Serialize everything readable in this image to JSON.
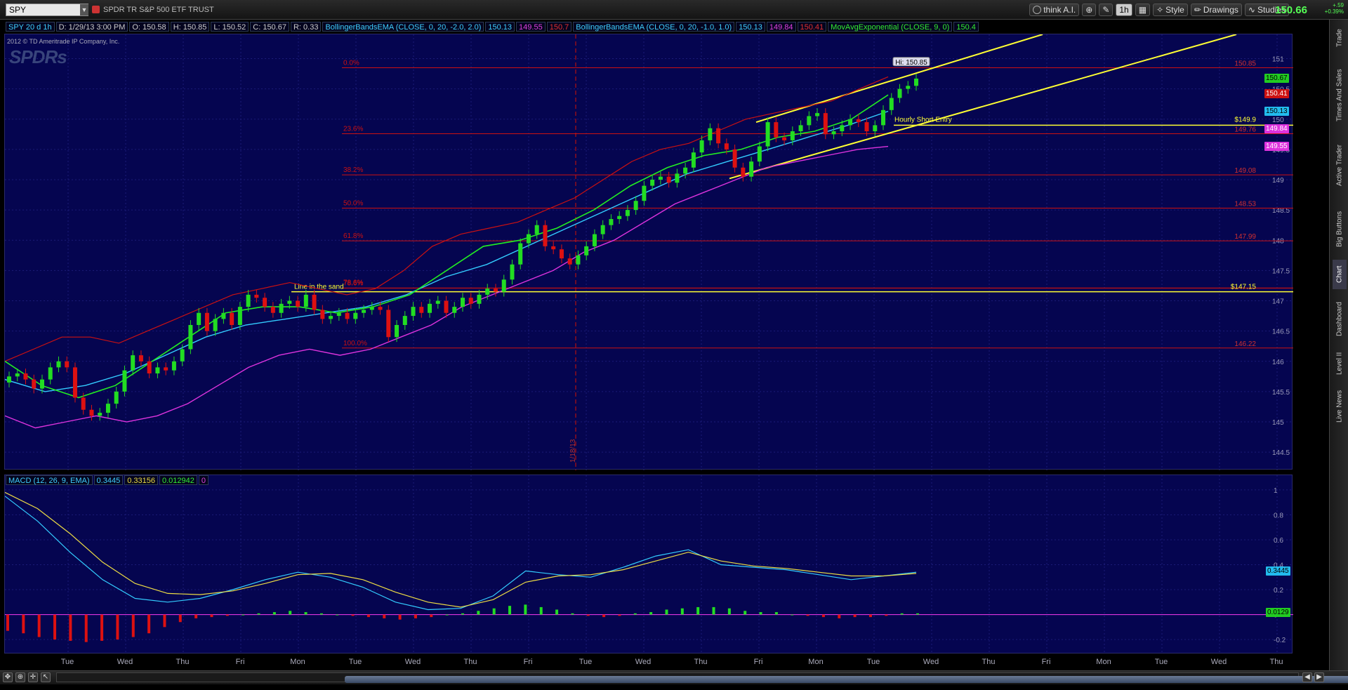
{
  "toolbar": {
    "symbol": "SPY",
    "symbol_title": "SPDR TR S&P 500 ETF TRUST",
    "think_label": "think A.I.",
    "timeframe": "1h",
    "style_label": "Style",
    "drawings_label": "Drawings",
    "studies_label": "Studies",
    "last_price": "150.66",
    "change_abs": "+.59",
    "change_pct": "+0.39%"
  },
  "studybar": {
    "period": "SPY 20 d 1h",
    "date": "D: 1/29/13 3:00 PM",
    "open": "O: 150.58",
    "high": "H: 150.85",
    "low": "L: 150.52",
    "close": "C: 150.67",
    "range": "R: 0.33",
    "bb1_name": "BollingerBandsEMA (CLOSE, 0, 20, -2.0, 2.0)",
    "bb1_mid": "150.13",
    "bb1_low": "149.55",
    "bb1_up": "150.7",
    "bb2_name": "BollingerBandsEMA (CLOSE, 0, 20, -1.0, 1.0)",
    "bb2_mid": "150.13",
    "bb2_low": "149.84",
    "bb2_up": "150.41",
    "ema_name": "MovAvgExponential (CLOSE, 9, 0)",
    "ema_val": "150.4"
  },
  "watermark": {
    "copyright": "2012 © TD Ameritrade IP Company, Inc.",
    "logo_text": "SPDRs"
  },
  "annotations": {
    "high_label": "Hi: 150.85",
    "hourly_short": "Hourly Short Entry",
    "line_in_sand": "Line in the sand",
    "date_marker": "1/18/13",
    "fib_0": "0.0%",
    "fib_236": "23.6%",
    "fib_382": "38.2%",
    "fib_50": "50.0%",
    "fib_618": "61.8%",
    "fib_786": "78.6%",
    "fib_100": "100.0%"
  },
  "price_tags": {
    "t_150_85": "150.85",
    "t_149_9": "$149.9",
    "t_149_76": "149.76",
    "t_149_08": "149.08",
    "t_148_53": "148.53",
    "t_147_99": "147.99",
    "t_147_15": "$147.15",
    "t_146_22": "146.22"
  },
  "axis_tags": {
    "last": "150.67",
    "bb_up": "150.41",
    "mid": "150.13",
    "bb_low1": "149.84",
    "bb_low2": "149.55",
    "macd_val": "0.3445",
    "hist_val": "0.0129"
  },
  "macd_legend": {
    "name": "MACD (12, 26, 9, EMA)",
    "value": "0.3445",
    "avg": "0.33156",
    "diff": "0.012942",
    "zero": "0"
  },
  "rail_tabs": [
    "Trade",
    "Times And Sales",
    "Active Trader",
    "Big Buttons",
    "Chart",
    "Dashboard",
    "Level II",
    "Live News"
  ],
  "colors": {
    "bg": "#050550",
    "up": "#22dd22",
    "down": "#dd1111",
    "yellow": "#ffff33",
    "cyan": "#33ccff",
    "magenta": "#dd33dd",
    "bb_outer": "#cc1111",
    "green_ema": "#22ee22",
    "fib": "#cc1111"
  },
  "chart_data": [
    {
      "type": "candlestick",
      "title": "SPY 20 d 1h",
      "x_day_labels": [
        "Tue",
        "Wed",
        "Thu",
        "Fri",
        "Mon",
        "Tue",
        "Wed",
        "Thu",
        "Fri",
        "Tue",
        "Wed",
        "Thu",
        "Fri",
        "Mon",
        "Tue",
        "Wed",
        "Thu",
        "Fri",
        "Mon",
        "Tue",
        "Wed",
        "Thu"
      ],
      "y_ticks": [
        144.5,
        145,
        145.5,
        146,
        146.5,
        147,
        147.5,
        148,
        148.5,
        149,
        149.5,
        150,
        150.5,
        151
      ],
      "ylim": [
        144.2,
        151.4
      ],
      "fib_levels": [
        {
          "label": "0.0%",
          "price": 150.85
        },
        {
          "label": "23.6%",
          "price": 149.76
        },
        {
          "label": "38.2%",
          "price": 149.08
        },
        {
          "label": "50.0%",
          "price": 148.53
        },
        {
          "label": "61.8%",
          "price": 147.99
        },
        {
          "label": "78.6%",
          "price": 147.21
        },
        {
          "label": "100.0%",
          "price": 146.22
        }
      ],
      "horizontal_lines": [
        {
          "label": "Line in the sand",
          "price": 147.15
        },
        {
          "label": "Hourly Short Entry",
          "price": 149.9
        }
      ],
      "closes": [
        145.75,
        145.8,
        145.7,
        145.55,
        145.7,
        145.9,
        146.0,
        145.9,
        145.4,
        145.2,
        145.1,
        145.15,
        145.3,
        145.5,
        145.85,
        146.1,
        146.0,
        145.8,
        145.9,
        145.85,
        146.0,
        146.2,
        146.6,
        146.8,
        146.5,
        146.7,
        146.8,
        146.6,
        146.9,
        147.1,
        147.05,
        146.9,
        146.8,
        146.95,
        147.0,
        146.9,
        147.1,
        146.85,
        146.7,
        146.75,
        146.8,
        146.7,
        146.8,
        146.85,
        146.9,
        146.85,
        146.4,
        146.6,
        146.75,
        146.9,
        146.8,
        146.95,
        147.0,
        146.8,
        146.9,
        147.05,
        146.95,
        147.1,
        147.2,
        147.15,
        147.35,
        147.6,
        147.95,
        148.1,
        148.25,
        147.9,
        147.85,
        147.7,
        147.6,
        147.75,
        147.9,
        148.1,
        148.25,
        148.35,
        148.4,
        148.5,
        148.65,
        148.9,
        149.0,
        149.05,
        148.95,
        149.1,
        149.2,
        149.45,
        149.65,
        149.85,
        149.6,
        149.5,
        149.2,
        149.05,
        149.3,
        149.55,
        149.95,
        149.7,
        149.65,
        149.8,
        149.9,
        150.05,
        150.1,
        149.75,
        149.8,
        149.9,
        150.0,
        149.95,
        149.8,
        149.9,
        150.15,
        150.35,
        150.5,
        150.55,
        150.67
      ],
      "bb_upper": [
        146.0,
        146.2,
        146.4,
        146.4,
        146.3,
        146.5,
        146.7,
        146.9,
        147.1,
        147.2,
        147.3,
        147.2,
        147.1,
        147.2,
        147.5,
        147.9,
        148.1,
        148.2,
        148.3,
        148.5,
        148.7,
        149.0,
        149.3,
        149.5,
        149.6,
        149.8,
        150.0,
        150.1,
        150.2,
        150.3,
        150.5,
        150.7
      ],
      "bb_lower": [
        145.1,
        144.9,
        145.0,
        145.1,
        145.0,
        145.1,
        145.3,
        145.6,
        145.9,
        146.1,
        146.2,
        146.1,
        146.2,
        146.4,
        146.6,
        146.9,
        147.1,
        147.3,
        147.5,
        147.8,
        148.0,
        148.3,
        148.6,
        148.8,
        149.0,
        149.2,
        149.3,
        149.4,
        149.5,
        149.55
      ],
      "ema9": [
        146.0,
        145.6,
        145.4,
        145.6,
        146.0,
        146.4,
        146.8,
        146.9,
        146.9,
        146.8,
        146.9,
        147.1,
        147.5,
        147.9,
        148.0,
        148.2,
        148.5,
        148.9,
        149.2,
        149.4,
        149.5,
        149.7,
        149.8,
        150.0,
        150.4
      ],
      "bb_mid": [
        145.7,
        145.5,
        145.6,
        145.8,
        146.1,
        146.4,
        146.6,
        146.7,
        146.8,
        146.9,
        147.1,
        147.4,
        147.6,
        147.9,
        148.2,
        148.5,
        148.8,
        149.1,
        149.3,
        149.5,
        149.7,
        149.9,
        150.13
      ]
    },
    {
      "type": "line",
      "title": "MACD (12, 26, 9, EMA)",
      "ylim": [
        -0.25,
        1.05
      ],
      "y_ticks": [
        -0.2,
        0,
        0.2,
        0.4,
        0.6,
        0.8,
        1
      ],
      "series": [
        {
          "name": "Value",
          "values": [
            0.95,
            0.75,
            0.5,
            0.28,
            0.13,
            0.1,
            0.13,
            0.2,
            0.28,
            0.34,
            0.3,
            0.22,
            0.1,
            0.04,
            0.05,
            0.15,
            0.35,
            0.32,
            0.3,
            0.38,
            0.47,
            0.52,
            0.4,
            0.38,
            0.36,
            0.32,
            0.28,
            0.31,
            0.34
          ]
        },
        {
          "name": "Avg",
          "values": [
            0.98,
            0.85,
            0.65,
            0.42,
            0.25,
            0.17,
            0.16,
            0.19,
            0.25,
            0.32,
            0.33,
            0.28,
            0.18,
            0.1,
            0.06,
            0.12,
            0.26,
            0.31,
            0.32,
            0.36,
            0.43,
            0.5,
            0.43,
            0.39,
            0.37,
            0.34,
            0.31,
            0.31,
            0.33
          ]
        }
      ],
      "histogram": [
        -0.13,
        -0.15,
        -0.18,
        -0.2,
        -0.21,
        -0.22,
        -0.21,
        -0.2,
        -0.18,
        -0.15,
        -0.1,
        -0.06,
        -0.03,
        -0.02,
        -0.01,
        0,
        0.01,
        0.02,
        0.03,
        0.02,
        0.01,
        0,
        -0.01,
        -0.02,
        -0.03,
        -0.04,
        -0.03,
        -0.02,
        0,
        0.01,
        0.03,
        0.05,
        0.07,
        0.08,
        0.06,
        0.04,
        0.01,
        -0.01,
        -0.02,
        -0.01,
        0.01,
        0.02,
        0.04,
        0.05,
        0.06,
        0.06,
        0.05,
        0.03,
        0.02,
        0.02,
        0,
        -0.01,
        -0.02,
        -0.03,
        -0.02,
        -0.02,
        -0.01,
        0.01,
        0.01
      ]
    }
  ]
}
